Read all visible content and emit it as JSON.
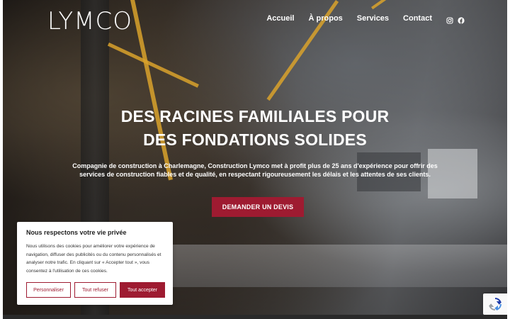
{
  "brand": {
    "logo_text": "LYMCO",
    "accent_color": "#9e1b31"
  },
  "nav": {
    "items": [
      "Accueil",
      "À propos",
      "Services",
      "Contact"
    ],
    "social": [
      "instagram-icon",
      "facebook-icon"
    ]
  },
  "hero": {
    "title_line1": "DES RACINES FAMILIALES POUR",
    "title_line2": "DES FONDATIONS SOLIDES",
    "subtitle": "Compagnie de construction à Charlemagne, Construction Lymco met à profit plus de 25 ans d'expérience pour offrir des services de construction fiables et de qualité, en respectant rigoureusement les délais et les attentes de ses clients.",
    "cta_label": "DEMANDER UN DEVIS"
  },
  "cookie": {
    "title": "Nous respectons votre vie privée",
    "text": "Nous utilisons des cookies pour améliorer votre expérience de navigation, diffuser des publicités ou du contenu personnalisés et analyser notre trafic. En cliquant sur « Accepter tout », vous consentez à l'utilisation de ces cookies.",
    "btn_customize": "Personnaliser",
    "btn_reject": "Tout refuser",
    "btn_accept": "Tout accepter"
  }
}
